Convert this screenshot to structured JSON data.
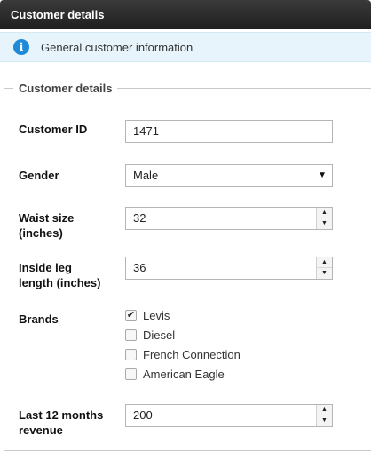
{
  "header": {
    "title": "Customer details"
  },
  "info": {
    "icon": "info-icon",
    "text": "General customer information"
  },
  "section": {
    "legend": "Customer details"
  },
  "fields": {
    "customer_id": {
      "label": "Customer ID",
      "value": "1471"
    },
    "gender": {
      "label": "Gender",
      "value": "Male"
    },
    "waist": {
      "label_line1": "Waist size",
      "label_line2": "(inches)",
      "value": "32"
    },
    "inside_leg": {
      "label_line1": "Inside leg",
      "label_line2": "length (inches)",
      "value": "36"
    },
    "revenue": {
      "label_line1": "Last 12 months",
      "label_line2": "revenue",
      "value": "200"
    }
  },
  "brands": {
    "label": "Brands",
    "options": [
      {
        "label": "Levis",
        "checked": true
      },
      {
        "label": "Diesel",
        "checked": false
      },
      {
        "label": "French Connection",
        "checked": false
      },
      {
        "label": "American Eagle",
        "checked": false
      }
    ]
  },
  "colors": {
    "header_bg": "#2a2a2a",
    "info_bg": "#e8f4fb",
    "info_icon": "#1f8ad8"
  }
}
